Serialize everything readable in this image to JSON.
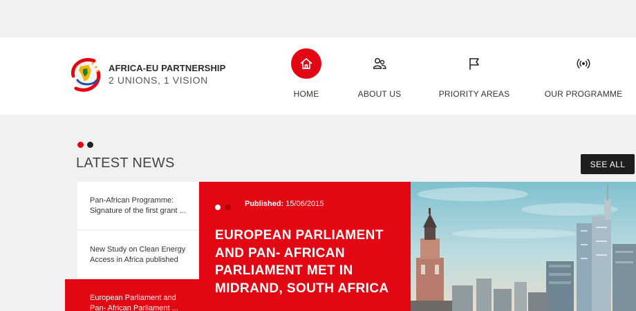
{
  "brand": {
    "name": "AFRICA-EU PARTNERSHIP",
    "tagline": "2 UNIONS, 1 VISION"
  },
  "nav": [
    {
      "label": "HOME",
      "icon": "home-icon",
      "active": true
    },
    {
      "label": "ABOUT US",
      "icon": "users-icon",
      "active": false
    },
    {
      "label": "PRIORITY AREAS",
      "icon": "flag-icon",
      "active": false
    },
    {
      "label": "OUR PROGRAMME",
      "icon": "broadcast-icon",
      "active": false
    }
  ],
  "news": {
    "title": "LATEST NEWS",
    "see_all": "SEE ALL",
    "items": [
      {
        "text": "Pan-African Programme: Signature of the first grant ..."
      },
      {
        "text": "New Study on Clean Energy Access in Africa published"
      },
      {
        "text": "European Parliament and Pan- African Parliament ...",
        "active": true
      }
    ],
    "featured": {
      "published_label": "Published:",
      "published_date": "15/06/2015",
      "title": "EUROPEAN PARLIAMENT AND PAN- AFRICAN PARLIAMENT MET IN MIDRAND, SOUTH AFRICA"
    }
  },
  "colors": {
    "accent": "#e30613",
    "dark": "#1e1e1e",
    "page_bg": "#f1f1f3"
  }
}
